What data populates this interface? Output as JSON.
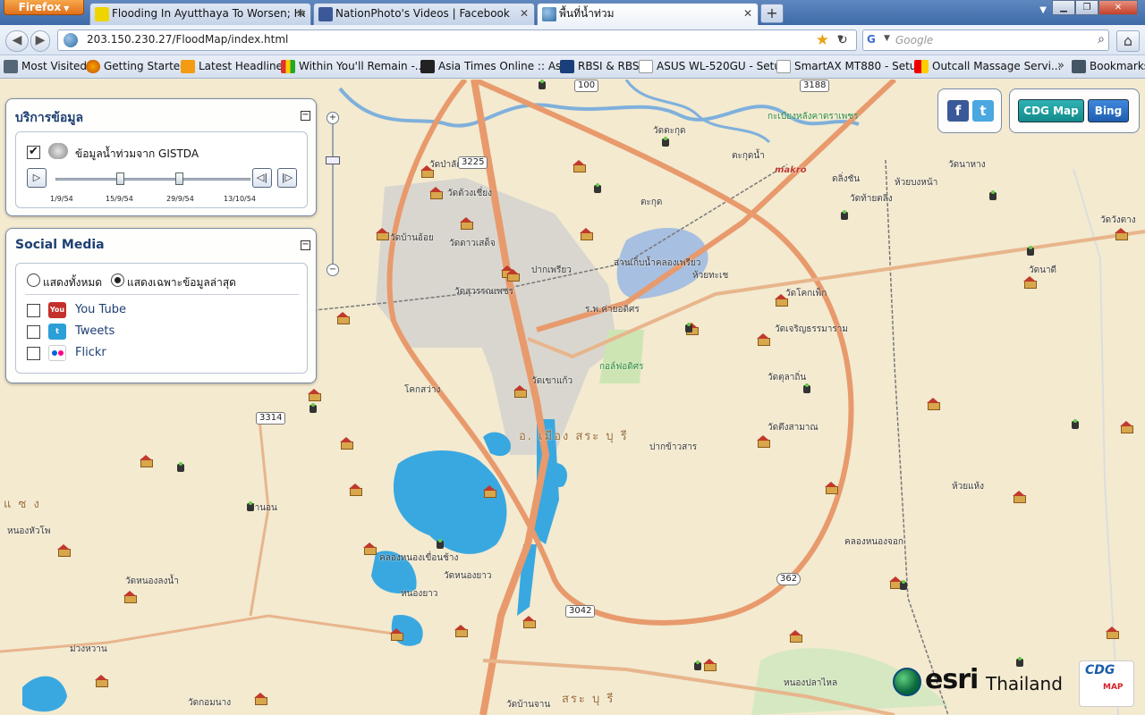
{
  "browser": {
    "app_button": "Firefox",
    "tabs": [
      {
        "label": "Flooding In Ayutthaya To Worsen; He...",
        "active": false
      },
      {
        "label": "NationPhoto's Videos | Facebook",
        "active": false
      },
      {
        "label": "พื้นที่น้ำท่วม",
        "active": true
      }
    ],
    "url": "203.150.230.27/FloodMap/index.html",
    "search_placeholder": "Google",
    "bookmarks": [
      "Most Visited",
      "Getting Started",
      "Latest Headlines",
      "Within You'll Remain -...",
      "Asia Times Online :: As...",
      "RBSI & RBS",
      "ASUS WL-520GU - Setup",
      "SmartAX MT880 - Setup",
      "Outcall Massage Servi..."
    ],
    "bookmarks_menu": "Bookmarks"
  },
  "data_panel": {
    "title": "บริการข้อมูล",
    "layer_label": "ข้อมูลน้ำท่วมจาก GISTDA",
    "layer_checked": true,
    "dates": [
      "1/9/54",
      "15/9/54",
      "29/9/54",
      "13/10/54"
    ]
  },
  "social_panel": {
    "title": "Social Media",
    "radio_all": "แสดงทั้งหมด",
    "radio_latest": "แสดงเฉพาะข้อมูลล่าสุด",
    "selected": "latest",
    "items": [
      {
        "label": "You Tube",
        "icon": "youtube-icon",
        "color": "#c4302b"
      },
      {
        "label": "Tweets",
        "icon": "twitter-icon",
        "color": "#2b9fd8"
      },
      {
        "label": "Flickr",
        "icon": "flickr-icon",
        "color": "#ff0084"
      }
    ]
  },
  "map_controls": {
    "cdg_map": "CDG Map",
    "bing": "Bing"
  },
  "branding": {
    "esri": "esri",
    "esri_country": "Thailand",
    "cdg": "CDG",
    "cdg_sub": "MAP"
  },
  "map": {
    "labels": [
      "วัดป่าลัก",
      "วัดด้วงเชี่ยง",
      "วัดบ้านอ้อย",
      "วัดดาวเสด็จ",
      "วัดสุวรรณเพชร",
      "ปากเพรียว",
      "ส่านเก็บน้ำคลองเพรียว",
      "ห้วยทะเช",
      "ร.พ.ค่ายอดิศร",
      "กอล์ฟอดิศร",
      "วัดเขาแก้ว",
      "โคกสว่าง",
      "ปากข้าวสาร",
      "ตะกุด",
      "วัดตะกุด",
      "วัดโคกเพ็ก",
      "วัดเจริญธรรมาราม",
      "วัดตุลาถิ่น",
      "วัดตึงสามาณ",
      "คลองหนองจอก",
      "ห้วยแห้ง",
      "หนองยาว",
      "วัดหนองยาว",
      "วัดบ้านจาน",
      "หนองปลาไหล",
      "ม่วงหวาน",
      "หนองหัวโพ",
      "วัดหนองลงน้ำ",
      "วัดกอมนาง",
      "คลองหนองเขื่อนช้าง",
      "ท่านอน",
      "ตะกุดน้ำ",
      "ตลิ่งชัน",
      "วัดท้ายตลิ่ง",
      "วัดนาหาง",
      "วัดวังตาง",
      "วัดนาดี",
      "ห้วยบงหน้า",
      "กะเบียงหลังคาตราเพชร"
    ],
    "district_label": "อ. เมือง สระ บุ รี",
    "province_label": "สระ บุ รี",
    "west_label": "แ ซ ง",
    "roads": [
      "3225",
      "3314",
      "3042",
      "362",
      "3188",
      "100"
    ],
    "brand_label": "makro"
  }
}
